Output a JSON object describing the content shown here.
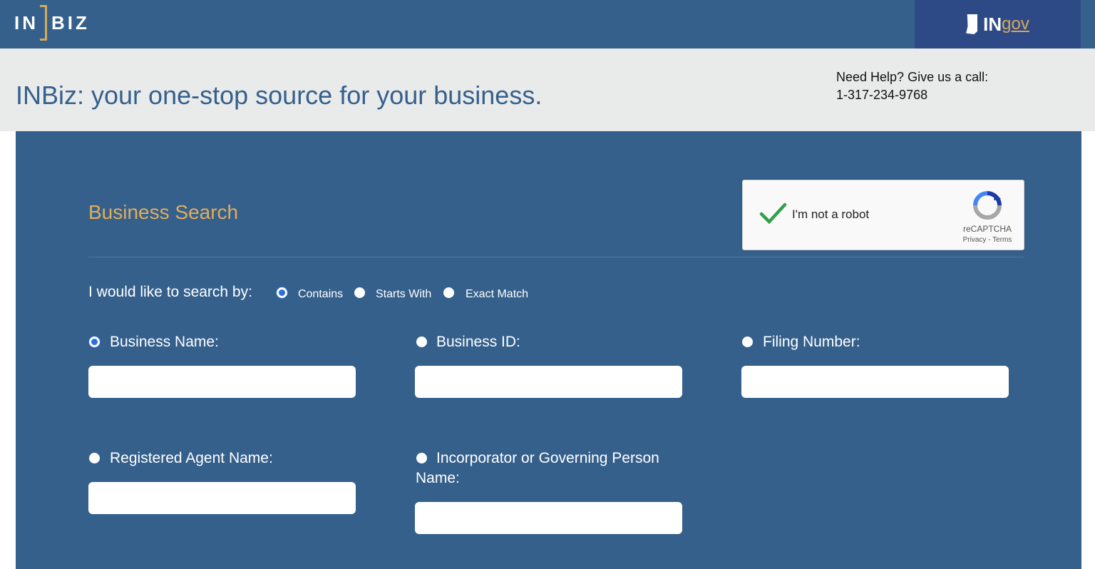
{
  "header": {
    "logo_left": "IN",
    "logo_right": "BIZ",
    "ingov_in": "IN",
    "ingov_gov": "gov"
  },
  "banner": {
    "tagline": "INBiz: your one-stop source for your business.",
    "help_line1": "Need Help? Give us a call:",
    "help_line2": "1-317-234-9768"
  },
  "search": {
    "title": "Business Search",
    "mode_label": "I would like to search by:",
    "modes": [
      "Contains",
      "Starts With",
      "Exact Match"
    ],
    "selected_mode": "Contains",
    "fields": {
      "business_name": "Business Name:",
      "business_id": "Business ID:",
      "filing_number": "Filing Number:",
      "registered_agent": "Registered Agent Name:",
      "incorporator_line1": "Incorporator or Governing Person",
      "incorporator_line2": "Name:"
    },
    "selected_field": "Business Name:"
  },
  "captcha": {
    "label": "I'm not a robot",
    "brand": "reCAPTCHA",
    "links": "Privacy - Terms"
  },
  "colors": {
    "primary": "#35608c",
    "accent": "#e0ad5a",
    "banner_bg": "#e9ebea",
    "gov_bg": "#2e4a86"
  }
}
